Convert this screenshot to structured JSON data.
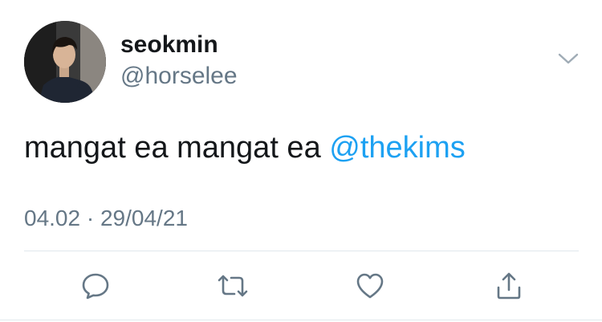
{
  "author": {
    "display_name": "seokmin",
    "handle": "@horselee",
    "avatar_icon": "profile-photo"
  },
  "tweet": {
    "text": "mangat ea mangat ea ",
    "mention": "@thekims",
    "time": "04.02",
    "separator": "·",
    "date": "29/04/21"
  },
  "actions": [
    {
      "name": "reply",
      "icon": "speech-bubble-icon"
    },
    {
      "name": "retweet",
      "icon": "retweet-arrows-icon"
    },
    {
      "name": "like",
      "icon": "heart-icon"
    },
    {
      "name": "share",
      "icon": "share-upload-icon"
    }
  ],
  "colors": {
    "text_primary": "#14171a",
    "text_secondary": "#657786",
    "accent": "#1da1f2",
    "divider": "#e1e8ed"
  }
}
